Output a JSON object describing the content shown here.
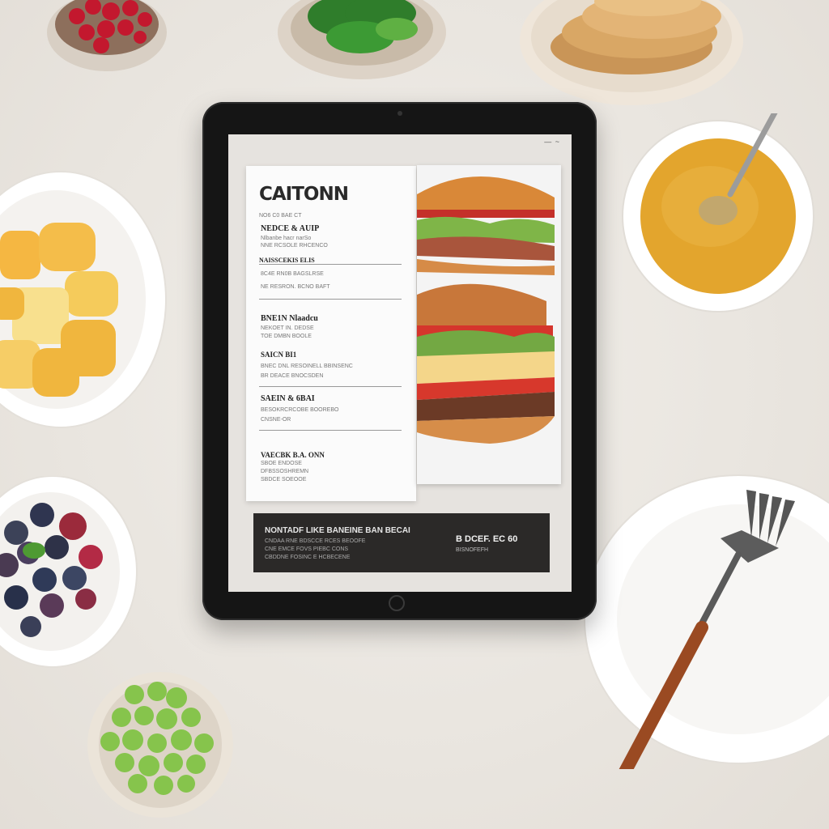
{
  "menu": {
    "title": "CAITONN",
    "subtitle": "NO6 C0 BAE CT",
    "items": [
      {
        "title": "NEDCE & AUIP",
        "lines": [
          "Nlbanbe hacr narSo",
          "NNE RCSOLE RHCENCO"
        ]
      },
      {
        "title": "NAISSCEKIS ELIS",
        "lines": [
          "8C4E RN0B BAGSLRSE",
          "NE RESRON. BCNO BAFT"
        ]
      },
      {
        "title": "BNE1N Nlaadcu",
        "lines": [
          "NEKOET IN. DEDSE",
          "TOE DMBN  BOOLE"
        ]
      },
      {
        "title": "SAICN BI1",
        "lines": [
          "BNEC DNL RESOINELL BBINSENC",
          "BR DEACE BNOCSDEN"
        ]
      },
      {
        "title": "SAEIN & 6BAI",
        "lines": [
          "BESOKRCRCOBE BOOREBO",
          "CNSNE-OR"
        ]
      },
      {
        "title": "VAECBK B.A. ONN",
        "lines": [
          "SBOE ENDOSE",
          "DFBSSOSHREMN",
          "SBDCE SOEOOE"
        ]
      }
    ]
  },
  "promo": {
    "title": "NONTADF LIKE BANEINE BAN BECAI",
    "lines": [
      "CNDAA RNE BDSCCE RCES BEOOFE",
      "CNE EMCE FOVS PIEBC CONS",
      "CBDDNE FOSINC E HCBECENE"
    ],
    "price": "B DCEF. EC 60",
    "price_note": "BISNOFEFH"
  },
  "status_marks": "— ~"
}
